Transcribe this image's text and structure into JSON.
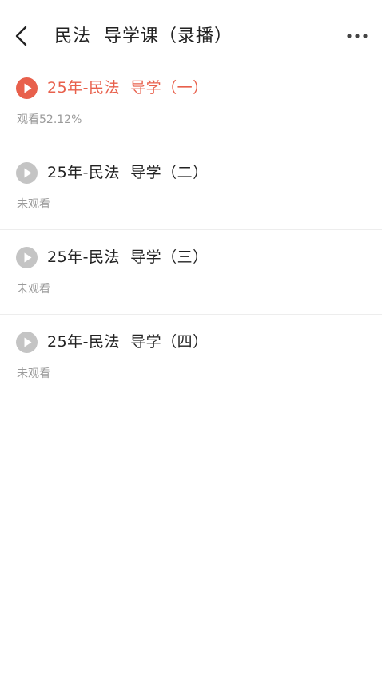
{
  "header": {
    "title": "民法  导学课（录播）",
    "back_icon": "chevron-left-icon",
    "more_icon": "more-horizontal-icon"
  },
  "colors": {
    "accent": "#e8604c",
    "inactive_icon": "#c4c4c4",
    "status_text": "#9a9a9a",
    "divider": "#ededed"
  },
  "lessons": [
    {
      "title": "25年-民法  导学（一）",
      "status": "观看52.12%",
      "active": true,
      "progress_percent": 52.12
    },
    {
      "title": "25年-民法  导学（二）",
      "status": "未观看",
      "active": false
    },
    {
      "title": "25年-民法  导学（三）",
      "status": "未观看",
      "active": false
    },
    {
      "title": "25年-民法  导学（四）",
      "status": "未观看",
      "active": false
    }
  ]
}
